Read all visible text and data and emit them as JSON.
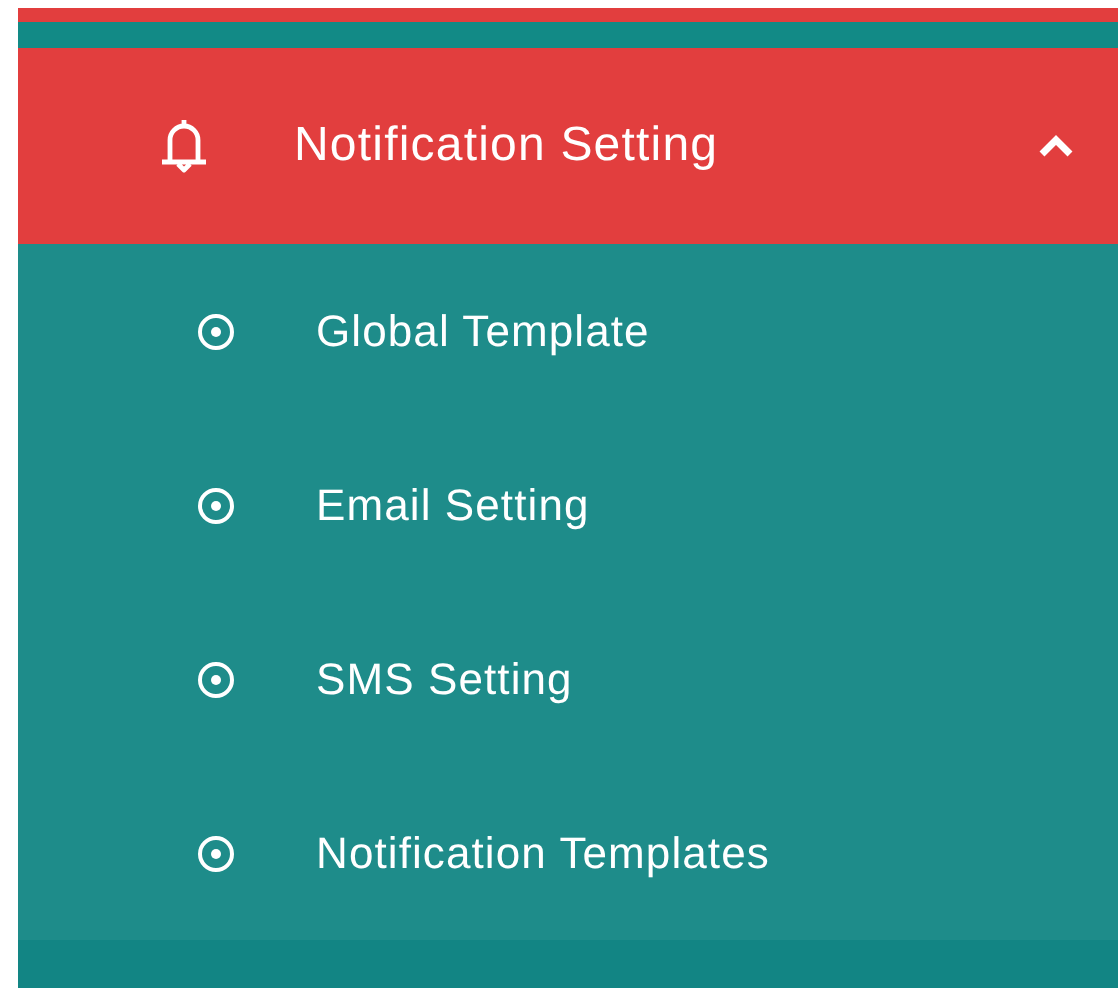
{
  "menu": {
    "label": "Notification Setting",
    "expanded": true,
    "selected": true,
    "children": [
      {
        "label": "Global Template"
      },
      {
        "label": "Email Setting"
      },
      {
        "label": "SMS Setting"
      },
      {
        "label": "Notification Templates"
      }
    ]
  }
}
